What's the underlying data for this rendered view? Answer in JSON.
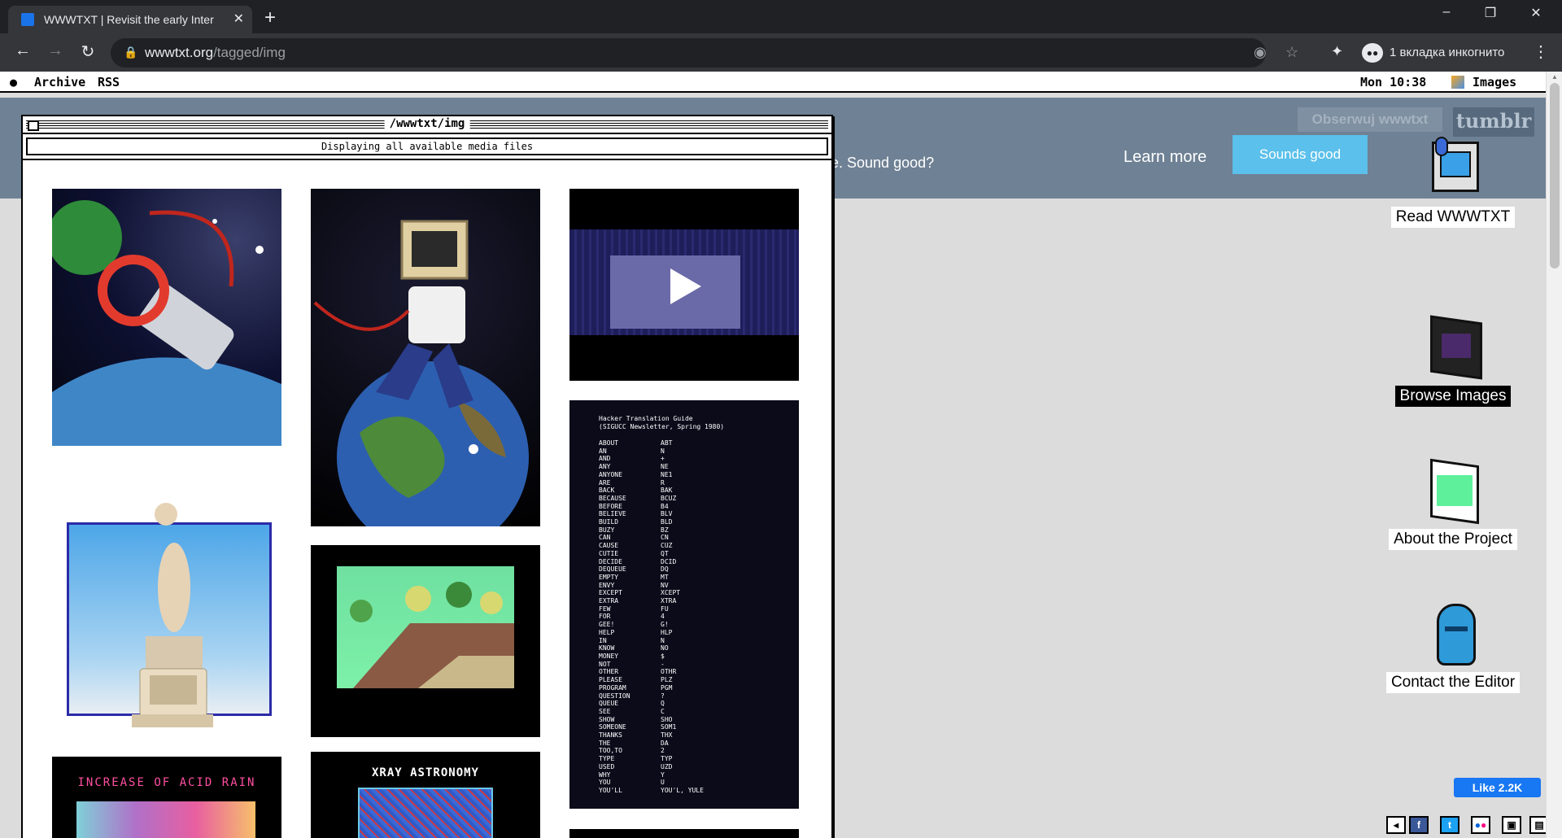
{
  "browser": {
    "tab_title": "WWWTXT | Revisit the early Inter",
    "tab_close": "✕",
    "new_tab": "+",
    "url_domain": "wwwtxt.org",
    "url_path": "/tagged/img",
    "incognito_label": "1 вкладка инкогнито"
  },
  "menubar": {
    "items": [
      "Archive",
      "RSS"
    ],
    "clock": "Mon 10:38",
    "images_label": "Images"
  },
  "cookie": {
    "text": "e. Sound good?",
    "learn_more": "Learn more",
    "accept": "Sounds good",
    "follow": "Obserwuj wwwtxt",
    "tumblr": "tumblr"
  },
  "window": {
    "title": "/wwwtxt/img",
    "subtitle": "Displaying all available media files"
  },
  "thumbnails": {
    "acid_rain_caption": "INCREASE OF ACID RAIN",
    "xray_caption": "XRAY ASTRONOMY",
    "hacker_title": "Hacker Translation Guide",
    "hacker_sub": "(SIGUCC Newsletter, Spring 1980)",
    "hacker_words": [
      "ABOUT",
      "AN",
      "AND",
      "ANY",
      "ANYONE",
      "ARE",
      "BACK",
      "BECAUSE",
      "BEFORE",
      "BELIEVE",
      "BUILD",
      "BUZY",
      "CAN",
      "CAUSE",
      "CUTIE",
      "DECIDE",
      "DEQUEUE",
      "EMPTY",
      "ENVY",
      "EXCEPT",
      "EXTRA",
      "FEW",
      "FOR",
      "GEE!",
      "HELP",
      "IN",
      "KNOW",
      "MONEY",
      "NOT",
      "OTHER",
      "PLEASE",
      "PROGRAM",
      "QUESTION",
      "QUEUE",
      "SEE",
      "SHOW",
      "SOMEONE",
      "THANKS",
      "THE",
      "TOO,TO",
      "TYPE",
      "USED",
      "WHY",
      "YOU",
      "YOU'LL"
    ],
    "hacker_abbr": [
      "ABT",
      "N",
      "+",
      "NE",
      "NE1",
      "R",
      "BAK",
      "BCUZ",
      "B4",
      "BLV",
      "BLD",
      "BZ",
      "CN",
      "CUZ",
      "QT",
      "DCID",
      "DQ",
      "MT",
      "NV",
      "XCEPT",
      "XTRA",
      "FU",
      "4",
      "G!",
      "HLP",
      "N",
      "NO",
      "$",
      "-",
      "OTHR",
      "PLZ",
      "PGM",
      "?",
      "Q",
      "C",
      "SHO",
      "SOM1",
      "THX",
      "DA",
      "2",
      "TYP",
      "UZD",
      "Y",
      "U",
      "YOU'L, YULE"
    ]
  },
  "desktop_icons": [
    {
      "label": "Read WWWTXT"
    },
    {
      "label": "Browse Images"
    },
    {
      "label": "About the Project"
    },
    {
      "label": "Contact the Editor"
    }
  ],
  "fb_like": "Like 2.2K"
}
